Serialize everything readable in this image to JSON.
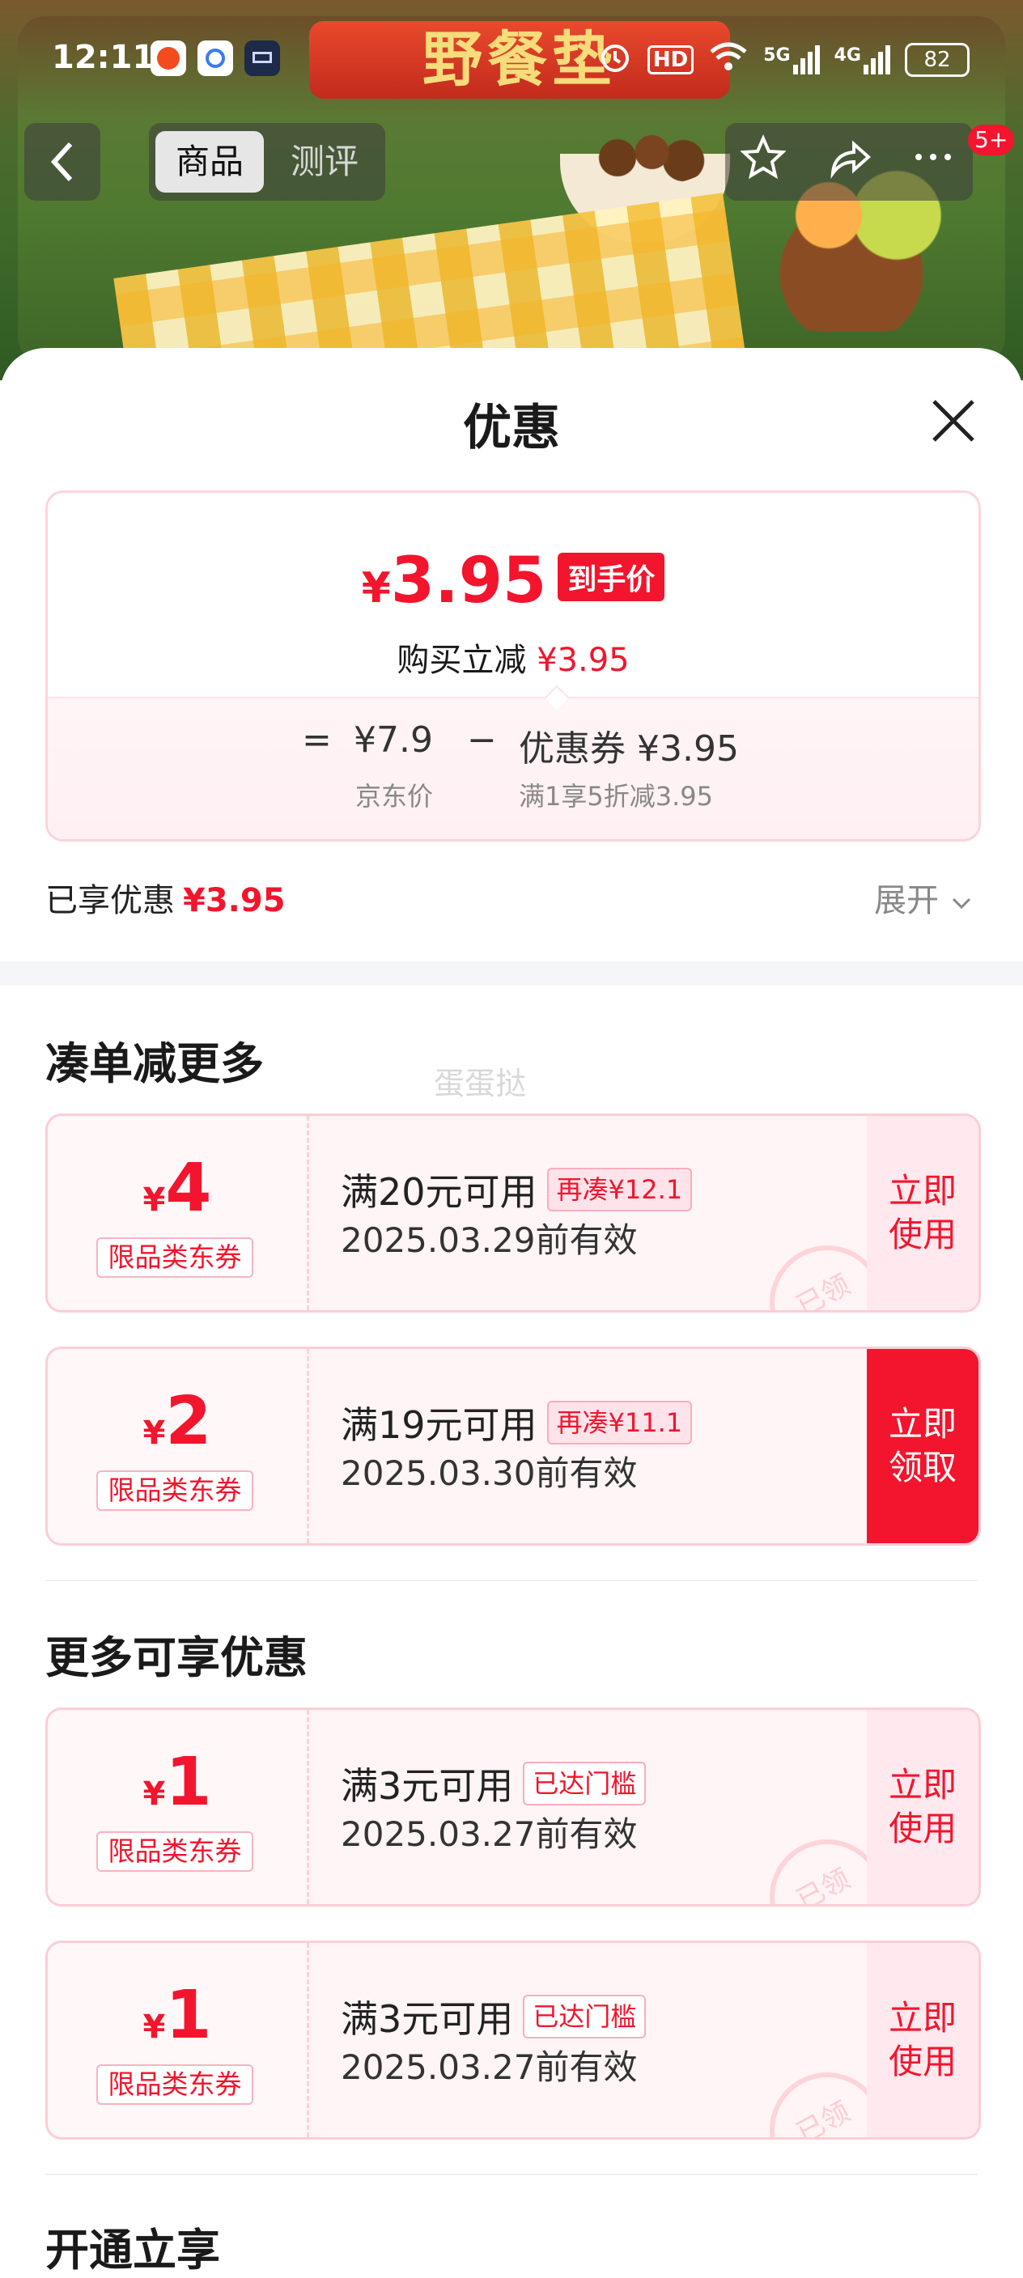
{
  "status_bar": {
    "time": "12:11",
    "hd": "HD",
    "net1": "5G",
    "net2": "4G",
    "battery": "82"
  },
  "banner": {
    "title": "野餐垫"
  },
  "nav": {
    "back_icon": "chevron-left-icon",
    "tabs": [
      {
        "label": "商品",
        "active": true
      },
      {
        "label": "测评",
        "active": false
      }
    ],
    "actions": [
      "star-icon",
      "share-icon",
      "more-icon"
    ],
    "badge": "5+"
  },
  "sheet": {
    "title": "优惠",
    "price": {
      "yen": "¥",
      "final": "3.95",
      "final_tag": "到手价",
      "reduce_label": "购买立减",
      "reduce_value": "¥3.95",
      "equals": "=",
      "jd_price": "¥7.9",
      "jd_price_label": "京东价",
      "minus": "−",
      "coupon_label": "优惠券",
      "coupon_value": "¥3.95",
      "coupon_note": "满1享5折减3.95"
    },
    "enjoyed": {
      "label": "已享优惠",
      "value": "¥3.95",
      "expand": "展开"
    },
    "watermark": "蛋蛋挞",
    "section1": "凑单减更多",
    "section2": "更多可享优惠",
    "section3": "开通立享",
    "coupons": [
      {
        "yen": "¥",
        "amount": "4",
        "kind": "限品类东券",
        "condition": "满20元可用",
        "tag": "再凑¥12.1",
        "date": "2025.03.29前有效",
        "button": "立即使用",
        "received": "已领"
      },
      {
        "yen": "¥",
        "amount": "2",
        "kind": "限品类东券",
        "condition": "满19元可用",
        "tag": "再凑¥11.1",
        "date": "2025.03.30前有效",
        "button": "立即领取"
      },
      {
        "yen": "¥",
        "amount": "1",
        "kind": "限品类东券",
        "condition": "满3元可用",
        "tag": "已达门槛",
        "date": "2025.03.27前有效",
        "button": "立即使用",
        "received": "已领"
      },
      {
        "yen": "¥",
        "amount": "1",
        "kind": "限品类东券",
        "condition": "满3元可用",
        "tag": "已达门槛",
        "date": "2025.03.27前有效",
        "button": "立即使用",
        "received": "已领"
      }
    ]
  },
  "colors": {
    "accent": "#f2152d",
    "coupon_bg": "#fff4f6",
    "border": "#fccdd7"
  }
}
